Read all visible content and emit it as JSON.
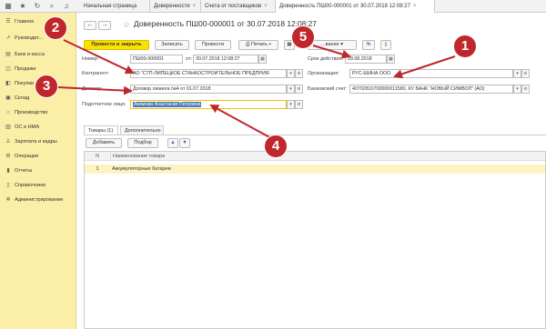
{
  "tabs": [
    {
      "label": "Начальная страница"
    },
    {
      "label": "Доверенности"
    },
    {
      "label": "Счета от поставщиков"
    },
    {
      "label": "Доверенность ПШ00-000001 от 30.07.2018 12:08:27"
    }
  ],
  "sidebar": {
    "items": [
      {
        "label": "Главное",
        "icon": "menu-icon"
      },
      {
        "label": "Руководит...",
        "icon": "chart-icon"
      },
      {
        "label": "Банк и касса",
        "icon": "bank-icon"
      },
      {
        "label": "Продажи",
        "icon": "cart-icon"
      },
      {
        "label": "Покупки",
        "icon": "bag-icon"
      },
      {
        "label": "Склад",
        "icon": "box-icon"
      },
      {
        "label": "Производство",
        "icon": "factory-icon"
      },
      {
        "label": "ОС и НМА",
        "icon": "assets-icon"
      },
      {
        "label": "Зарплата и кадры",
        "icon": "people-icon"
      },
      {
        "label": "Операции",
        "icon": "operations-icon"
      },
      {
        "label": "Отчеты",
        "icon": "report-icon"
      },
      {
        "label": "Справочники",
        "icon": "book-icon"
      },
      {
        "label": "Администрирование",
        "icon": "gear-icon"
      }
    ]
  },
  "form": {
    "title": "Доверенность ПШ00-000001 от 30.07.2018 12:08:27",
    "toolbar": {
      "post_close": "Провести и закрыть",
      "write": "Записать",
      "post": "Провести",
      "print": "Печать",
      "more_partial": "...вание"
    },
    "number_label": "Номер:",
    "number": "ПШ00-000001",
    "date_label": "от:",
    "date": "30.07.2018 12:08:27",
    "validity_label": "Срок действия:",
    "validity": "09.08.2018",
    "counterparty_label": "Контрагент:",
    "counterparty": "АО \"СТП-ЛИПЕЦКОЕ СТАНКОСТРОИТЕЛЬНОЕ ПРЕДПРИЯ",
    "organization_label": "Организация:",
    "organization": "РУС-ШИНА ООО",
    "contract_label": "Договор:",
    "contract": "Договор лизинга №4 от 01.07.2018",
    "bank_account_label": "Банковский счет:",
    "bank_account": "40702810700000011580, КУ БАНК \"НОВЫЙ СИМВОЛ\" (АО)",
    "person_label": "Подотчетное лицо:",
    "person": "Акимова Анастасия Петровна",
    "subtabs": [
      "Товары (1)",
      "Дополнительно"
    ],
    "add_button": "Добавить",
    "pick_button": "Подбор",
    "grid": {
      "headers": [
        "N",
        "Наименование товара"
      ],
      "rows": [
        {
          "n": "1",
          "name": "Аккумуляторные батареи"
        }
      ]
    }
  },
  "callouts": [
    "1",
    "2",
    "3",
    "4",
    "5"
  ],
  "colors": {
    "sidebar": "#fbeea6",
    "primary_button": "#fbe100",
    "callout": "#c0272d"
  }
}
